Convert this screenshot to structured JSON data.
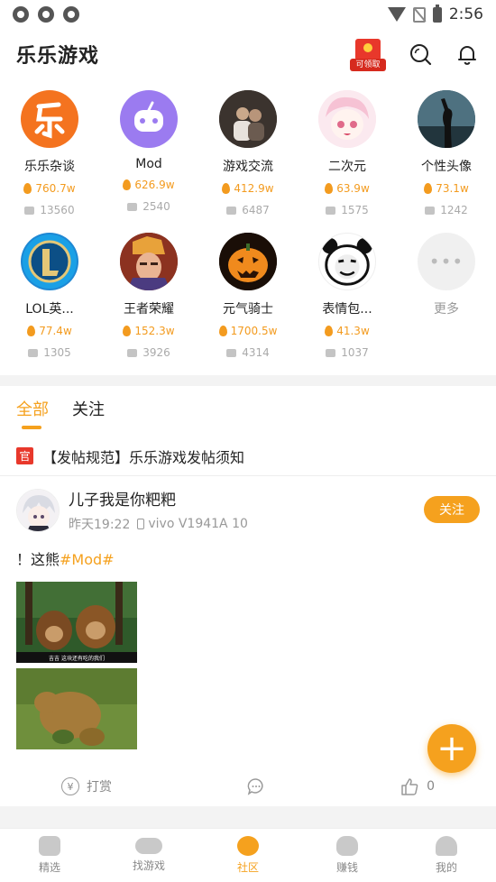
{
  "status": {
    "time": "2:56"
  },
  "header": {
    "title": "乐乐游戏",
    "gift_label": "可领取"
  },
  "categories": [
    {
      "name": "乐乐杂谈",
      "heat": "760.7w",
      "posts": "13560"
    },
    {
      "name": "Mod",
      "heat": "626.9w",
      "posts": "2540"
    },
    {
      "name": "游戏交流",
      "heat": "412.9w",
      "posts": "6487"
    },
    {
      "name": "二次元",
      "heat": "63.9w",
      "posts": "1575"
    },
    {
      "name": "个性头像",
      "heat": "73.1w",
      "posts": "1242"
    },
    {
      "name": "LOL英...",
      "heat": "77.4w",
      "posts": "1305"
    },
    {
      "name": "王者荣耀",
      "heat": "152.3w",
      "posts": "3926"
    },
    {
      "name": "元气骑士",
      "heat": "1700.5w",
      "posts": "4314"
    },
    {
      "name": "表情包...",
      "heat": "41.3w",
      "posts": "1037"
    },
    {
      "name": "更多"
    }
  ],
  "tabs": [
    {
      "label": "全部"
    },
    {
      "label": "关注"
    }
  ],
  "notice": {
    "badge": "官",
    "text": "【发帖规范】乐乐游戏发帖须知"
  },
  "post": {
    "user": "儿子我是你粑粑",
    "time": "昨天19:22",
    "device": "vivo V1941A 10",
    "follow_label": "关注",
    "text_prefix": "！这熊",
    "tag": "#Mod#",
    "image_caption": "吉吉  这块还有吃的我们",
    "reward_label": "打赏",
    "like_count": "0"
  },
  "bottom_nav": [
    {
      "label": "精选"
    },
    {
      "label": "找游戏"
    },
    {
      "label": "社区"
    },
    {
      "label": "赚钱"
    },
    {
      "label": "我的"
    }
  ],
  "colors": {
    "accent": "#f5a11e",
    "red": "#e8382b"
  }
}
